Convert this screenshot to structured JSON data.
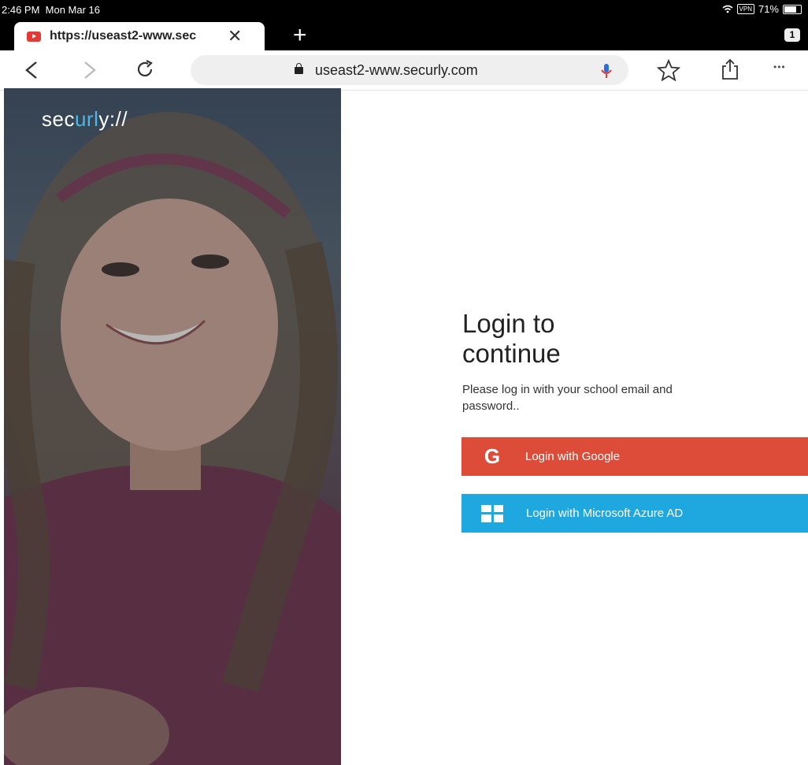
{
  "status_bar": {
    "time": "2:46 PM",
    "date": "Mon Mar 16",
    "vpn": "VPN",
    "battery": "71%"
  },
  "tab": {
    "title": "https://useast2-www.sec",
    "close": "✕",
    "new_tab": "+",
    "count": "1"
  },
  "toolbar": {
    "back": "‹",
    "forward": "›",
    "reload": "↻",
    "url": "useast2-www.securly.com",
    "more": "•••"
  },
  "brand": {
    "prefix": "sec",
    "accent": "url",
    "suffix": "y://"
  },
  "login": {
    "heading_line1": "Login to",
    "heading_line2": "continue",
    "subtitle": "Please log in with your school email and password..",
    "google_label": "Login with Google",
    "google_icon": "G",
    "microsoft_label": "Login with Microsoft Azure AD"
  },
  "colors": {
    "google": "#dd4b39",
    "microsoft": "#1fa7e0",
    "brand_accent": "#4ab8e8",
    "tab_strip": "#000000"
  },
  "icons": [
    "youtube-favicon-icon",
    "close-icon",
    "plus-icon",
    "back-icon",
    "forward-icon",
    "reload-icon",
    "lock-icon",
    "microphone-icon",
    "star-icon",
    "share-icon",
    "more-icon",
    "wifi-icon",
    "battery-icon",
    "google-icon",
    "windows-icon"
  ]
}
